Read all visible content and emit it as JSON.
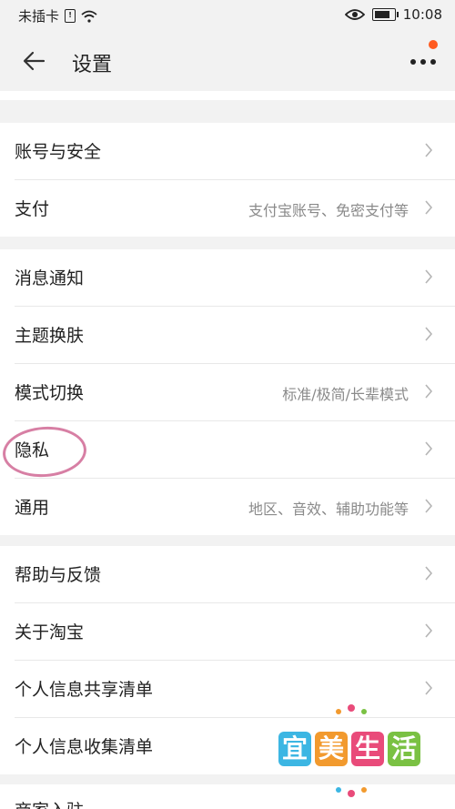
{
  "status_bar": {
    "carrier": "未插卡",
    "time": "10:08"
  },
  "header": {
    "title": "设置"
  },
  "sections": [
    {
      "rows": [
        {
          "label": "账号与安全",
          "hint": ""
        },
        {
          "label": "支付",
          "hint": "支付宝账号、免密支付等"
        }
      ]
    },
    {
      "rows": [
        {
          "label": "消息通知",
          "hint": ""
        },
        {
          "label": "主题换肤",
          "hint": ""
        },
        {
          "label": "模式切换",
          "hint": "标准/极简/长辈模式"
        },
        {
          "label": "隐私",
          "hint": ""
        },
        {
          "label": "通用",
          "hint": "地区、音效、辅助功能等"
        }
      ]
    },
    {
      "rows": [
        {
          "label": "帮助与反馈",
          "hint": ""
        },
        {
          "label": "关于淘宝",
          "hint": ""
        },
        {
          "label": "个人信息共享清单",
          "hint": ""
        },
        {
          "label": "个人信息收集清单",
          "hint": ""
        }
      ]
    }
  ],
  "bottom_peek_label": "商家入驻",
  "watermark": {
    "chars": [
      "宜",
      "美",
      "生",
      "活"
    ],
    "colors": [
      "#3cb6e3",
      "#f29a2e",
      "#e94b7a",
      "#7ac143"
    ]
  },
  "colors": {
    "accent_dot": "#ff5a1f",
    "highlight_circle": "#d77fa4"
  }
}
